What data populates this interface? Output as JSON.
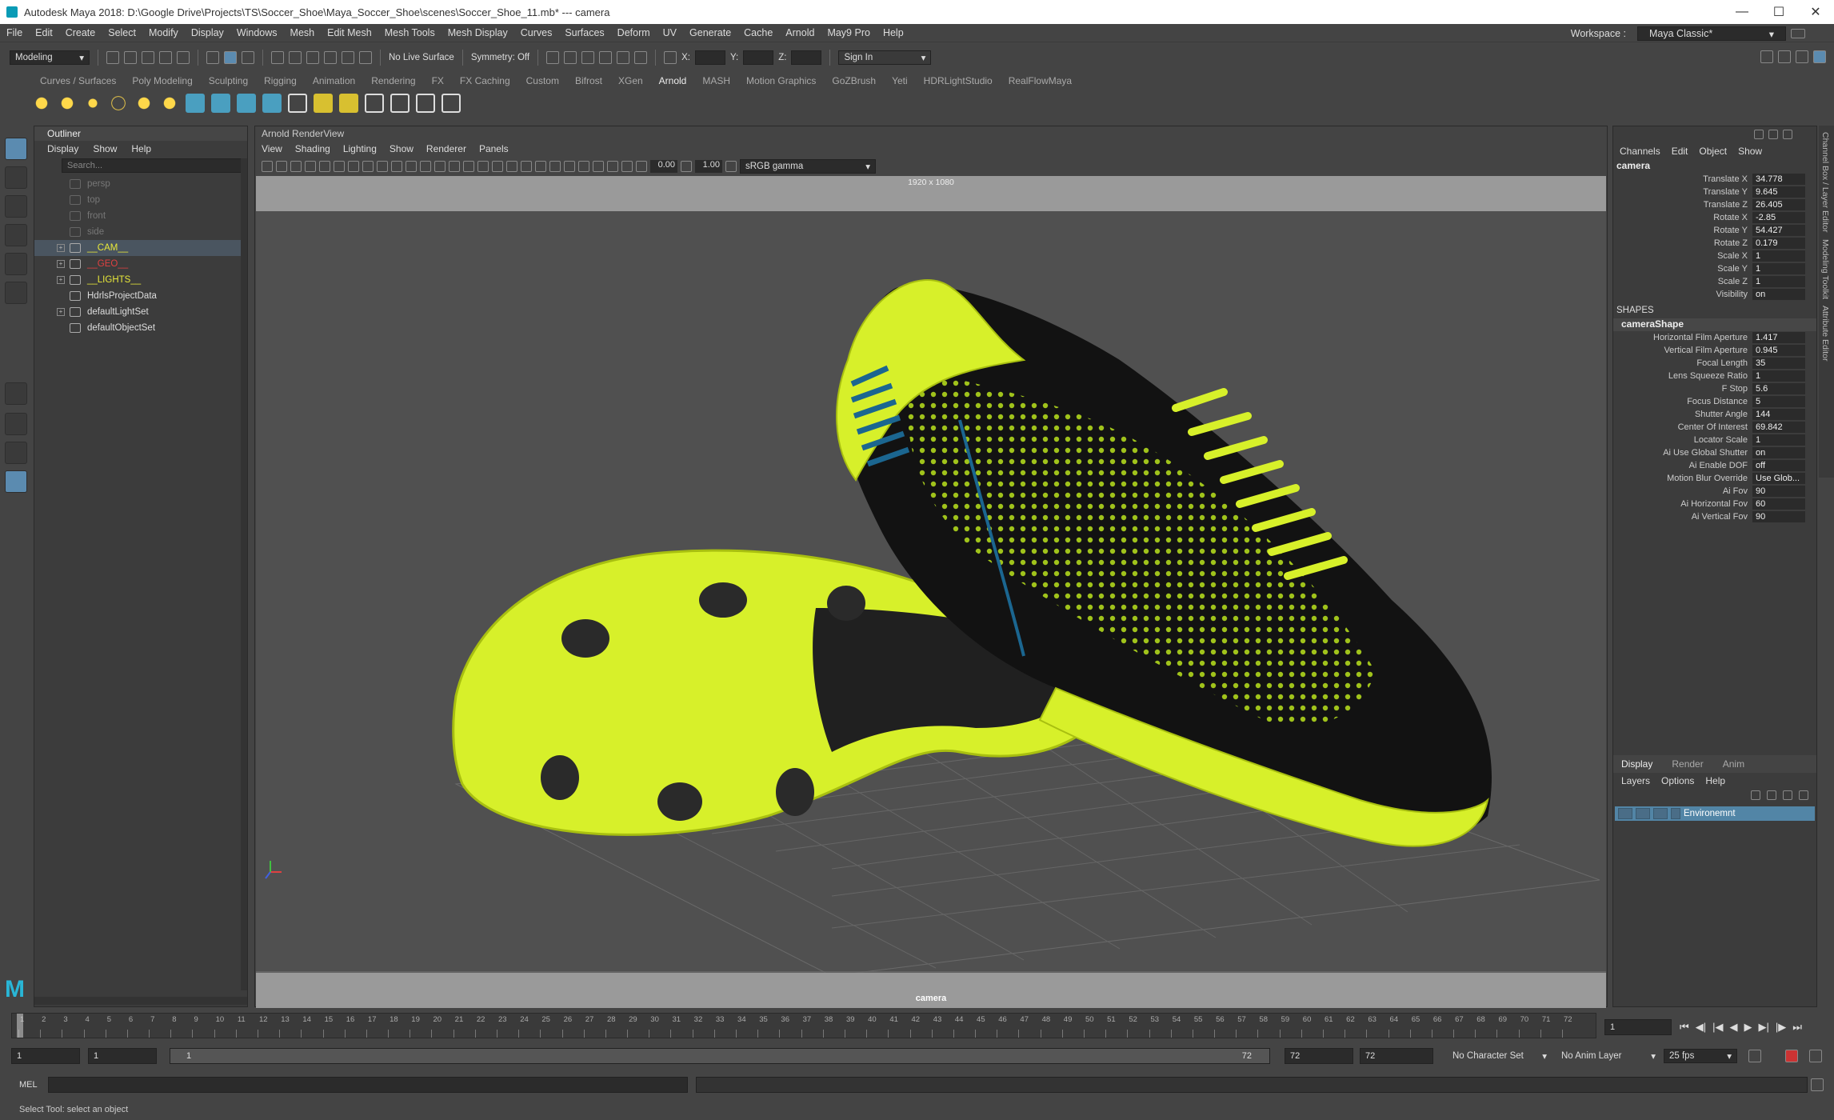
{
  "window": {
    "title": "Autodesk Maya 2018: D:\\Google Drive\\Projects\\TS\\Soccer_Shoe\\Maya_Soccer_Shoe\\scenes\\Soccer_Shoe_11.mb*   ---   camera"
  },
  "menubar": {
    "items": [
      "File",
      "Edit",
      "Create",
      "Select",
      "Modify",
      "Display",
      "Windows",
      "Mesh",
      "Edit Mesh",
      "Mesh Tools",
      "Mesh Display",
      "Curves",
      "Surfaces",
      "Deform",
      "UV",
      "Generate",
      "Cache",
      "Arnold",
      "May9 Pro",
      "Help"
    ],
    "workspace_label": "Workspace :",
    "workspace_value": "Maya Classic*"
  },
  "statusline": {
    "mode": "Modeling",
    "live_surface": "No Live Surface",
    "symmetry": "Symmetry: Off",
    "x_label": "X:",
    "y_label": "Y:",
    "z_label": "Z:",
    "sign_in": "Sign In"
  },
  "shelf": {
    "tabs": [
      "Curves / Surfaces",
      "Poly Modeling",
      "Sculpting",
      "Rigging",
      "Animation",
      "Rendering",
      "FX",
      "FX Caching",
      "Custom",
      "Bifrost",
      "XGen",
      "Arnold",
      "MASH",
      "Motion Graphics",
      "GoZBrush",
      "Yeti",
      "HDRLightStudio",
      "RealFlowMaya"
    ],
    "active_tab": "Arnold"
  },
  "outliner": {
    "title": "Outliner",
    "menu": [
      "Display",
      "Show",
      "Help"
    ],
    "search_placeholder": "Search...",
    "items": [
      {
        "label": "persp",
        "color": "#777777",
        "expandable": false
      },
      {
        "label": "top",
        "color": "#777777",
        "expandable": false
      },
      {
        "label": "front",
        "color": "#777777",
        "expandable": false
      },
      {
        "label": "side",
        "color": "#777777",
        "expandable": false
      },
      {
        "label": "__CAM__",
        "color": "#e8e83a",
        "expandable": true,
        "selected": true
      },
      {
        "label": "__GEO__",
        "color": "#e04040",
        "expandable": true
      },
      {
        "label": "__LIGHTS__",
        "color": "#e8e83a",
        "expandable": true
      },
      {
        "label": "HdrlsProjectData",
        "color": "#dddddd",
        "expandable": false
      },
      {
        "label": "defaultLightSet",
        "color": "#dddddd",
        "expandable": true
      },
      {
        "label": "defaultObjectSet",
        "color": "#dddddd",
        "expandable": false
      }
    ]
  },
  "viewport": {
    "panel_title": "Arnold RenderView",
    "menu": [
      "View",
      "Shading",
      "Lighting",
      "Show",
      "Renderer",
      "Panels"
    ],
    "exposure": "0.00",
    "gamma": "1.00",
    "color_space": "sRGB gamma",
    "resolution": "1920 x 1080",
    "camera_label": "camera"
  },
  "channelbox": {
    "menu": [
      "Channels",
      "Edit",
      "Object",
      "Show"
    ],
    "object": "camera",
    "attrs": [
      {
        "label": "Translate X",
        "value": "34.778"
      },
      {
        "label": "Translate Y",
        "value": "9.645"
      },
      {
        "label": "Translate Z",
        "value": "26.405"
      },
      {
        "label": "Rotate X",
        "value": "-2.85"
      },
      {
        "label": "Rotate Y",
        "value": "54.427"
      },
      {
        "label": "Rotate Z",
        "value": "0.179"
      },
      {
        "label": "Scale X",
        "value": "1"
      },
      {
        "label": "Scale Y",
        "value": "1"
      },
      {
        "label": "Scale Z",
        "value": "1"
      },
      {
        "label": "Visibility",
        "value": "on"
      }
    ],
    "shapes_header": "SHAPES",
    "shape_name": "cameraShape",
    "shape_attrs": [
      {
        "label": "Horizontal Film Aperture",
        "value": "1.417"
      },
      {
        "label": "Vertical Film Aperture",
        "value": "0.945"
      },
      {
        "label": "Focal Length",
        "value": "35"
      },
      {
        "label": "Lens Squeeze Ratio",
        "value": "1"
      },
      {
        "label": "F Stop",
        "value": "5.6"
      },
      {
        "label": "Focus Distance",
        "value": "5"
      },
      {
        "label": "Shutter Angle",
        "value": "144"
      },
      {
        "label": "Center Of Interest",
        "value": "69.842"
      },
      {
        "label": "Locator Scale",
        "value": "1"
      },
      {
        "label": "Ai Use Global Shutter",
        "value": "on"
      },
      {
        "label": "Ai Enable DOF",
        "value": "off"
      },
      {
        "label": "Motion Blur Override",
        "value": "Use Glob..."
      },
      {
        "label": "Ai Fov",
        "value": "90"
      },
      {
        "label": "Ai Horizontal Fov",
        "value": "60"
      },
      {
        "label": "Ai Vertical Fov",
        "value": "90"
      }
    ],
    "side_tabs": [
      "Channel Box / Layer Editor",
      "Modeling Toolkit",
      "Attribute Editor"
    ]
  },
  "layereditor": {
    "tabs": [
      "Display",
      "Render",
      "Anim"
    ],
    "menu": [
      "Layers",
      "Options",
      "Help"
    ],
    "layer_name": "Environemnt"
  },
  "timeslider": {
    "ticks": [
      "1",
      "2",
      "3",
      "4",
      "5",
      "6",
      "7",
      "8",
      "9",
      "10",
      "11",
      "12",
      "13",
      "14",
      "15",
      "16",
      "17",
      "18",
      "19",
      "20",
      "21",
      "22",
      "23",
      "24",
      "25",
      "26",
      "27",
      "28",
      "29",
      "30",
      "31",
      "32",
      "33",
      "34",
      "35",
      "36",
      "37",
      "38",
      "39",
      "40",
      "41",
      "42",
      "43",
      "44",
      "45",
      "46",
      "47",
      "48",
      "49",
      "50",
      "51",
      "52",
      "53",
      "54",
      "55",
      "56",
      "57",
      "58",
      "59",
      "60",
      "61",
      "62",
      "63",
      "64",
      "65",
      "66",
      "67",
      "68",
      "69",
      "70",
      "71",
      "72"
    ],
    "current_frame": "1"
  },
  "rangeslider": {
    "start": "1",
    "anim_start": "1",
    "range_inner_start": "1",
    "range_inner_end": "72",
    "anim_end": "72",
    "end": "72",
    "character_set": "No Character Set",
    "anim_layer": "No Anim Layer",
    "fps": "25 fps"
  },
  "commandline": {
    "lang": "MEL"
  },
  "helpline": {
    "text": "Select Tool: select an object"
  }
}
